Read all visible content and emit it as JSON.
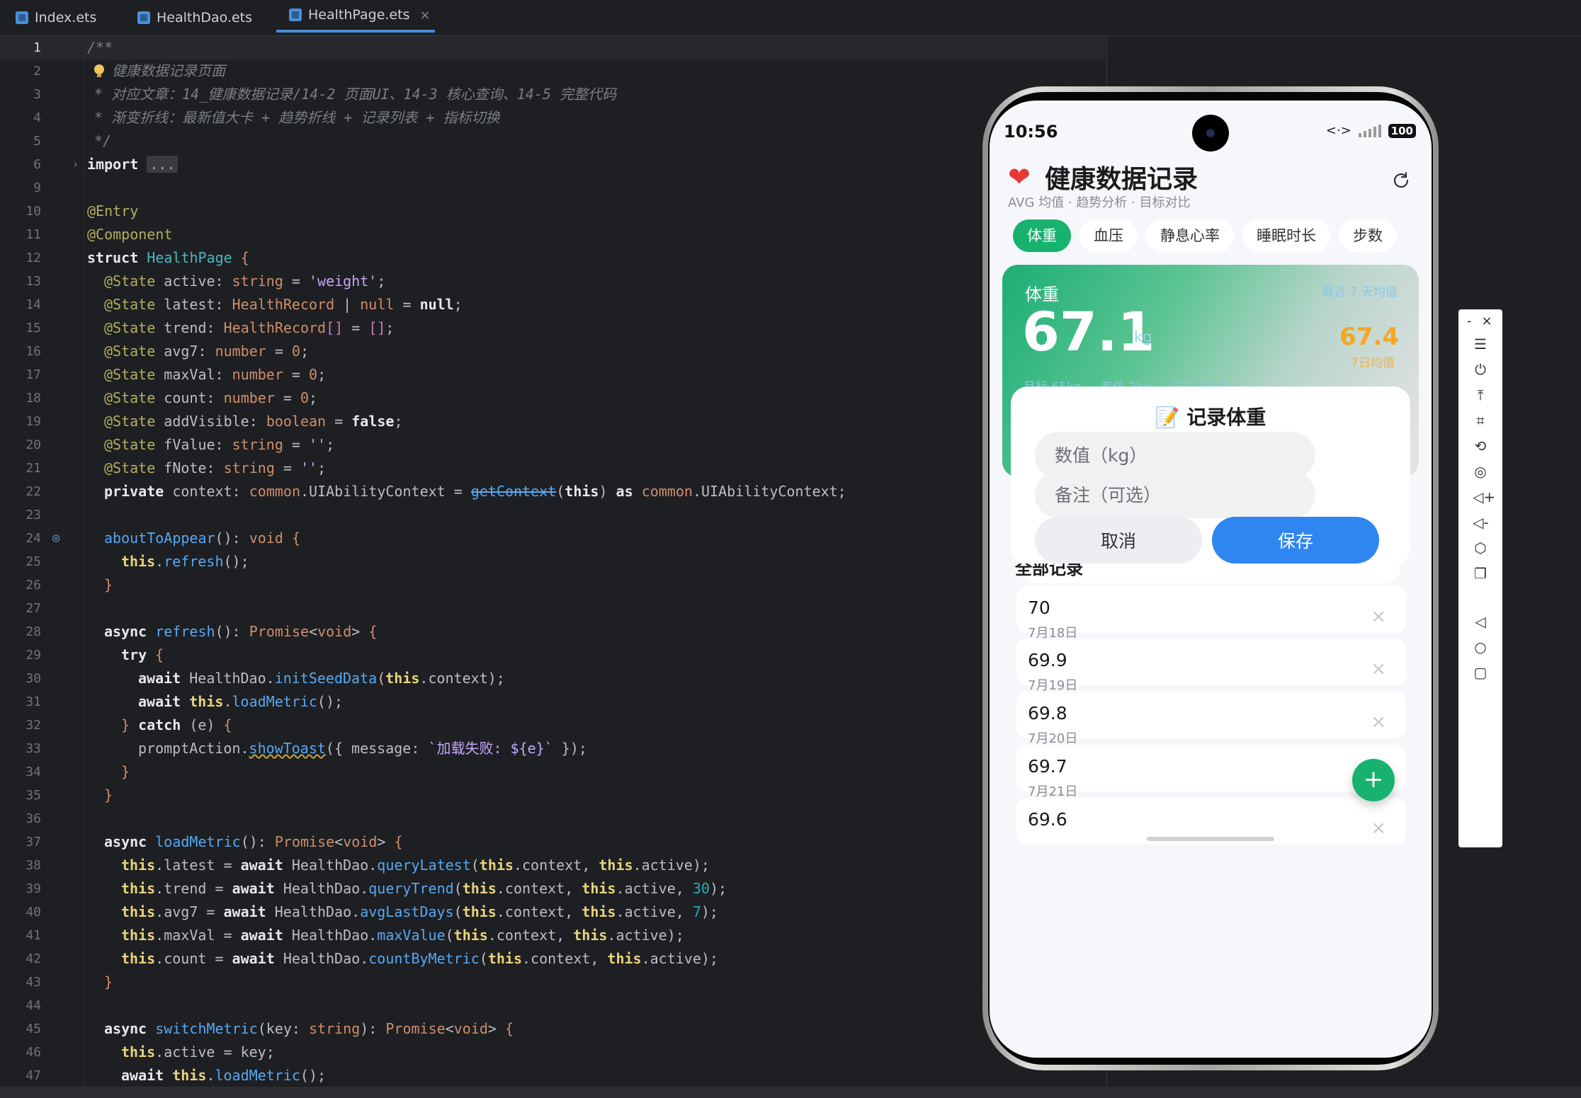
{
  "tabs": [
    {
      "label": "Index.ets",
      "active": false
    },
    {
      "label": "HealthDao.ets",
      "active": false
    },
    {
      "label": "HealthPage.ets",
      "active": true,
      "closable": "×"
    }
  ],
  "code_lines": [
    {
      "n": "1"
    },
    {
      "n": "2"
    },
    {
      "n": "3"
    },
    {
      "n": "4"
    },
    {
      "n": "5"
    },
    {
      "n": "6"
    },
    {
      "n": "9"
    },
    {
      "n": "10"
    },
    {
      "n": "11"
    },
    {
      "n": "12"
    },
    {
      "n": "13"
    },
    {
      "n": "14"
    },
    {
      "n": "15"
    },
    {
      "n": "16"
    },
    {
      "n": "17"
    },
    {
      "n": "18"
    },
    {
      "n": "19"
    },
    {
      "n": "20"
    },
    {
      "n": "21"
    },
    {
      "n": "22"
    },
    {
      "n": "23"
    },
    {
      "n": "24"
    },
    {
      "n": "25"
    },
    {
      "n": "26"
    },
    {
      "n": "27"
    },
    {
      "n": "28"
    },
    {
      "n": "29"
    },
    {
      "n": "30"
    },
    {
      "n": "31"
    },
    {
      "n": "32"
    },
    {
      "n": "33"
    },
    {
      "n": "34"
    },
    {
      "n": "35"
    },
    {
      "n": "36"
    },
    {
      "n": "37"
    },
    {
      "n": "38"
    },
    {
      "n": "39"
    },
    {
      "n": "40"
    },
    {
      "n": "41"
    },
    {
      "n": "42"
    },
    {
      "n": "43"
    },
    {
      "n": "44"
    },
    {
      "n": "45"
    },
    {
      "n": "46"
    },
    {
      "n": "47"
    }
  ],
  "code_text": {
    "c1": "/**",
    "c2": "健康数据记录页面",
    "c3": "* 对应文章：14_健康数据记录/14-2 页面UI、14-3 核心查询、14-5 完整代码",
    "c4": "* 渐变折线：最新值大卡 + 趋势折线 + 记录列表 + 指标切换",
    "c5": "*/",
    "import_kw": "import",
    "fold": "...",
    "entry": "@Entry",
    "component": "@Component",
    "struct_kw": "struct",
    "struct_name": "HealthPage",
    "s_active": "active",
    "s_latest": "latest",
    "s_trend": "trend",
    "s_avg7": "avg7",
    "s_maxVal": "maxVal",
    "s_count": "count",
    "s_addVisible": "addVisible",
    "s_fValue": "fValue",
    "s_fNote": "fNote",
    "state": "@State",
    "weight_str": "'weight'",
    "empty_str": "''",
    "ctx_line_private": "private",
    "ctx_line_context": "context",
    "ctx_common": "common",
    "ctx_type": "UIAbilityContext",
    "ctx_get": "getContext",
    "toast": "`加载失败: ${e}`",
    "fn_about": "aboutToAppear",
    "fn_refresh": "refresh",
    "fn_load": "loadMetric",
    "fn_switch": "switchMetric",
    "dao": "HealthDao",
    "initSeed": "initSeedData",
    "qLatest": "queryLatest",
    "qTrend": "queryTrend",
    "avgLast": "avgLastDays",
    "maxValue": "maxValue",
    "countBy": "countByMetric",
    "prompt": "promptAction",
    "showToast": "showToast"
  },
  "phone": {
    "time": "10:56",
    "net": "<·>",
    "battery": "100",
    "header_icon": "heart-icon",
    "title": "健康数据记录",
    "subtitle": "AVG 均值 · 趋势分析 · 目标对比",
    "refresh_icon": "refresh-icon",
    "metric_tabs": [
      "体重",
      "血压",
      "静息心率",
      "睡眠时长",
      "步数"
    ],
    "active_tab": "体重",
    "hero": {
      "label": "体重",
      "right_label": "最近 7 天均值",
      "value": "67.1",
      "unit": "kg",
      "avg_value": "67.4",
      "avg_label": "7日均值",
      "foot_target": "目标 65kg",
      "foot_gap": "差值 2kg",
      "foot_count": "记录 30 条"
    },
    "dialog": {
      "title": "📝 记录体重",
      "value_placeholder": "数值（kg）",
      "note_placeholder": "备注（可选）",
      "cancel": "取消",
      "save": "保存"
    },
    "list_title": "全部记录",
    "records": [
      {
        "value": "70",
        "date": "7月18日"
      },
      {
        "value": "69.9",
        "date": "7月19日"
      },
      {
        "value": "69.8",
        "date": "7月20日"
      },
      {
        "value": "69.7",
        "date": "7月21日"
      },
      {
        "value": "69.6",
        "date": ""
      }
    ],
    "delete_glyph": "×",
    "fab_label": "+"
  },
  "emulator_toolbar": {
    "minimize": "-",
    "close": "×",
    "icons": [
      "menu-icon",
      "power-icon",
      "pin-top-icon",
      "crop-icon",
      "rotate-icon",
      "screenshot-icon",
      "volume-up-icon",
      "volume-down-icon",
      "shake-icon",
      "multi-screen-icon",
      "back-icon",
      "home-icon",
      "recents-icon"
    ]
  },
  "colors": {
    "accent_green": "#18b26f",
    "save_blue": "#2f86f0",
    "avg_orange": "#f5a623",
    "editor_bg": "#1e1f22"
  }
}
